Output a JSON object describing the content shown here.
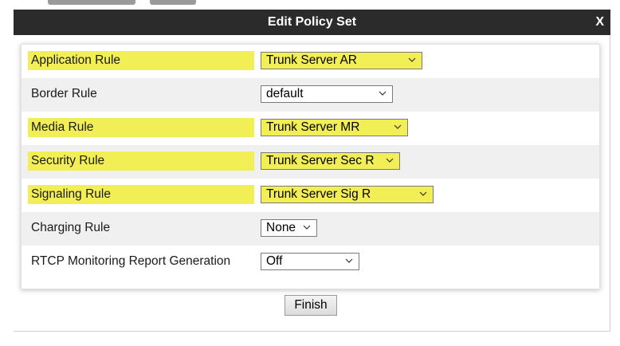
{
  "dialog": {
    "title": "Edit Policy Set",
    "close_label": "X"
  },
  "rules": [
    {
      "label": "Application Rule",
      "value": "Trunk Server AR",
      "highlighted": true
    },
    {
      "label": "Border Rule",
      "value": "default",
      "highlighted": false
    },
    {
      "label": "Media Rule",
      "value": "Trunk Server MR",
      "highlighted": true
    },
    {
      "label": "Security Rule",
      "value": "Trunk Server Sec R",
      "highlighted": true
    },
    {
      "label": "Signaling Rule",
      "value": "Trunk Server Sig R",
      "highlighted": true
    },
    {
      "label": "Charging Rule",
      "value": "None",
      "highlighted": false
    },
    {
      "label": "RTCP Monitoring Report Generation",
      "value": "Off",
      "highlighted": false
    }
  ],
  "footer": {
    "finish_label": "Finish"
  },
  "colors": {
    "titlebar": "#2b2b2b",
    "highlight": "#f2ee55",
    "row_shade": "#f0f0f0"
  },
  "icons": {
    "dropdown": "chevron-down-icon"
  }
}
